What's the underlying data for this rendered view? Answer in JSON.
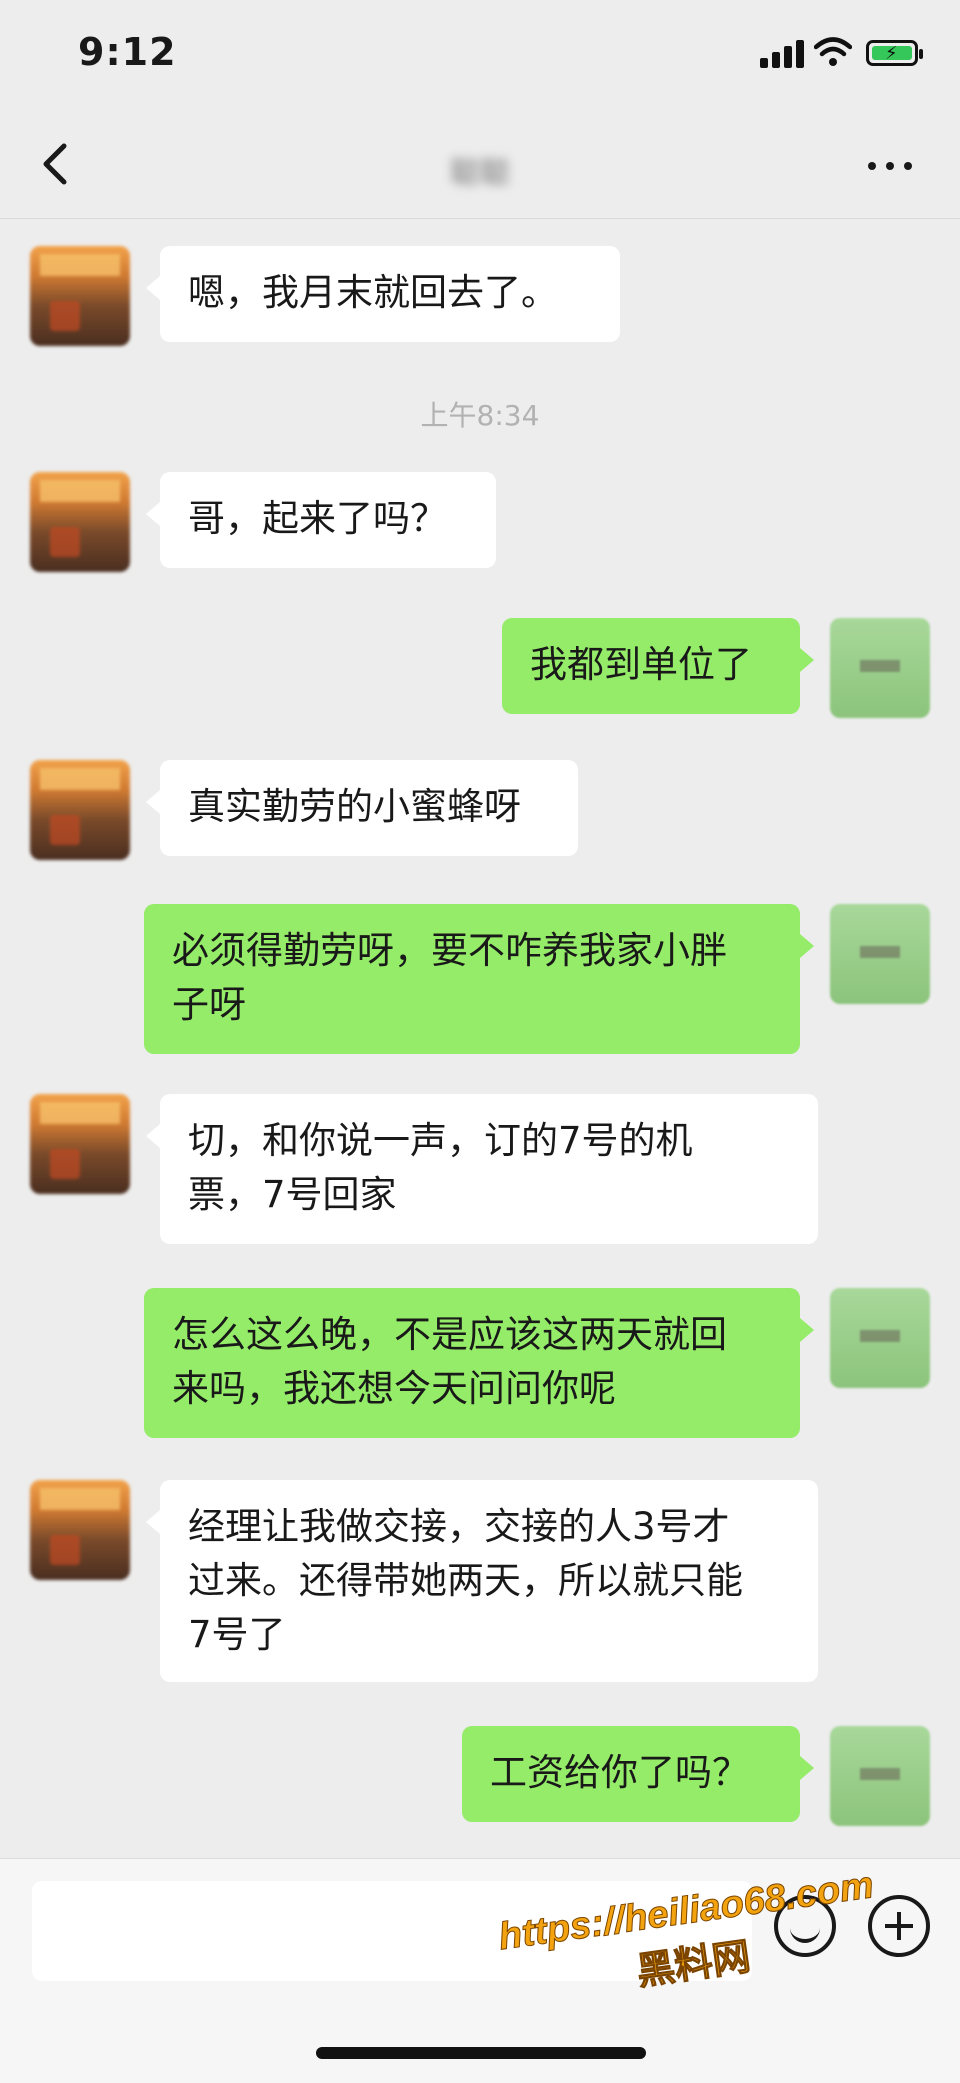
{
  "status_bar": {
    "time": "9:12"
  },
  "nav": {
    "title": "聪聪"
  },
  "messages": [
    {
      "side": "in",
      "text": "嗯，我月末就回去了。"
    },
    {
      "type": "time",
      "text": "上午8:34"
    },
    {
      "side": "in",
      "text": "哥，起来了吗？"
    },
    {
      "side": "out",
      "text": "我都到单位了"
    },
    {
      "side": "in",
      "text": "真实勤劳的小蜜蜂呀"
    },
    {
      "side": "out",
      "text": "必须得勤劳呀，要不咋养我家小胖\n子呀"
    },
    {
      "side": "in",
      "text": "切，和你说一声，订的7号的机\n票，7号回家"
    },
    {
      "side": "out",
      "text": "怎么这么晚，不是应该这两天就回\n来吗，我还想今天问问你呢"
    },
    {
      "side": "in",
      "text": "经理让我做交接，交接的人3号才\n过来。还得带她两天，所以就只能\n7号了"
    },
    {
      "side": "out",
      "text": "工资给你了吗？"
    }
  ],
  "watermark": {
    "url": "https://heiliao68.com",
    "name": "黑料网"
  },
  "colors": {
    "background": "#ededed",
    "outgoing_bubble": "#95ec69",
    "incoming_bubble": "#ffffff"
  },
  "icons": [
    "back-icon",
    "more-icon",
    "emoji-icon",
    "plus-icon",
    "signal-icon",
    "wifi-icon",
    "battery-icon"
  ]
}
